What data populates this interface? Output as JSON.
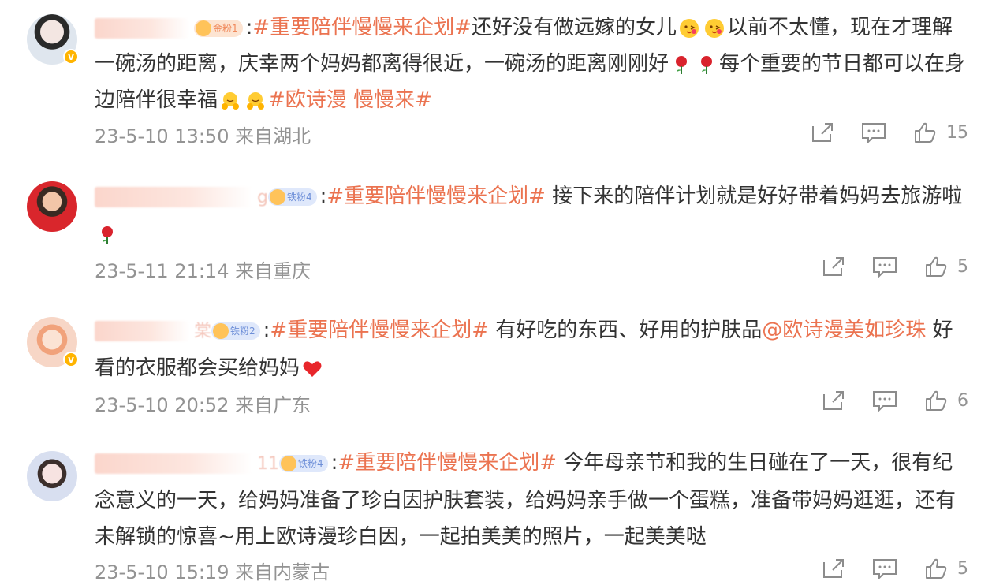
{
  "comments": [
    {
      "name_suffix": "",
      "fan_badge": "金粉1",
      "text_parts": {
        "tag": "#重要陪伴慢慢来企划#",
        "t1": "还好没有做远嫁的女儿",
        "t2": "以前不太懂，现在才理解一碗汤的距离，庆幸两个妈妈都离得很近，一碗汤的距离刚刚好",
        "t3": "每个重要的节日都可以在身边陪伴很幸福",
        "tag2": "#欧诗漫 慢慢来#"
      },
      "meta": "23-5-10 13:50 来自湖北",
      "likes": "15"
    },
    {
      "name_suffix": "g",
      "fan_badge": "铁粉4",
      "text_parts": {
        "tag": "#重要陪伴慢慢来企划#",
        "t1": " 接下来的陪伴计划就是好好带着妈妈去旅游啦"
      },
      "meta": "23-5-11 21:14 来自重庆",
      "likes": "5"
    },
    {
      "name_suffix": "棠",
      "fan_badge": "铁粉2",
      "text_parts": {
        "tag": "#重要陪伴慢慢来企划#",
        "t1": " 有好吃的东西、好用的护肤品",
        "mention": "@欧诗漫美如珍珠",
        "t2": " 好看的衣服都会买给妈妈"
      },
      "meta": "23-5-10 20:52 来自广东",
      "likes": "6"
    },
    {
      "name_suffix": "11",
      "fan_badge": "铁粉4",
      "text_parts": {
        "tag": "#重要陪伴慢慢来企划#",
        "t1": " 今年母亲节和我的生日碰在了一天，很有纪念意义的一天，给妈妈准备了珍白因护肤套装，给妈妈亲手做一个蛋糕，准备带妈妈逛逛，还有未解锁的惊喜~用上欧诗漫珍白因，一起拍美美的照片，一起美美哒"
      },
      "meta": "23-5-10 15:19 来自内蒙古",
      "likes": "5"
    }
  ],
  "colon": ":",
  "icons": [
    "share-icon",
    "comment-icon",
    "like-icon",
    "rose-icon",
    "hug-icon",
    "heart-icon",
    "smile-kiss-icon"
  ],
  "colors": {
    "accent": "#eb7350",
    "meta": "#939393",
    "text": "#333333"
  }
}
